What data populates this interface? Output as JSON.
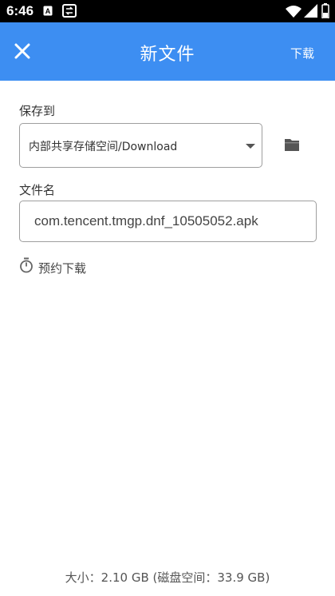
{
  "status_bar": {
    "time": "6:46"
  },
  "app_bar": {
    "title": "新文件",
    "download_label": "下载"
  },
  "form": {
    "save_to_label": "保存到",
    "save_to_value": "内部共享存储空间/Download",
    "filename_label": "文件名",
    "filename_value": "com.tencent.tmgp.dnf_10505052.apk",
    "schedule_label": "预约下载"
  },
  "footer": {
    "size_text": "大小：2.10 GB (磁盘空间：33.9 GB)"
  },
  "colors": {
    "app_bar": "#3d8ef2",
    "status_bar": "#000000",
    "text": "#333333",
    "border": "#9e9e9e"
  },
  "icons": [
    "a-badge-icon",
    "sync-icon",
    "wifi-icon",
    "signal-icon",
    "battery-icon",
    "close-icon",
    "folder-icon",
    "timer-icon"
  ]
}
